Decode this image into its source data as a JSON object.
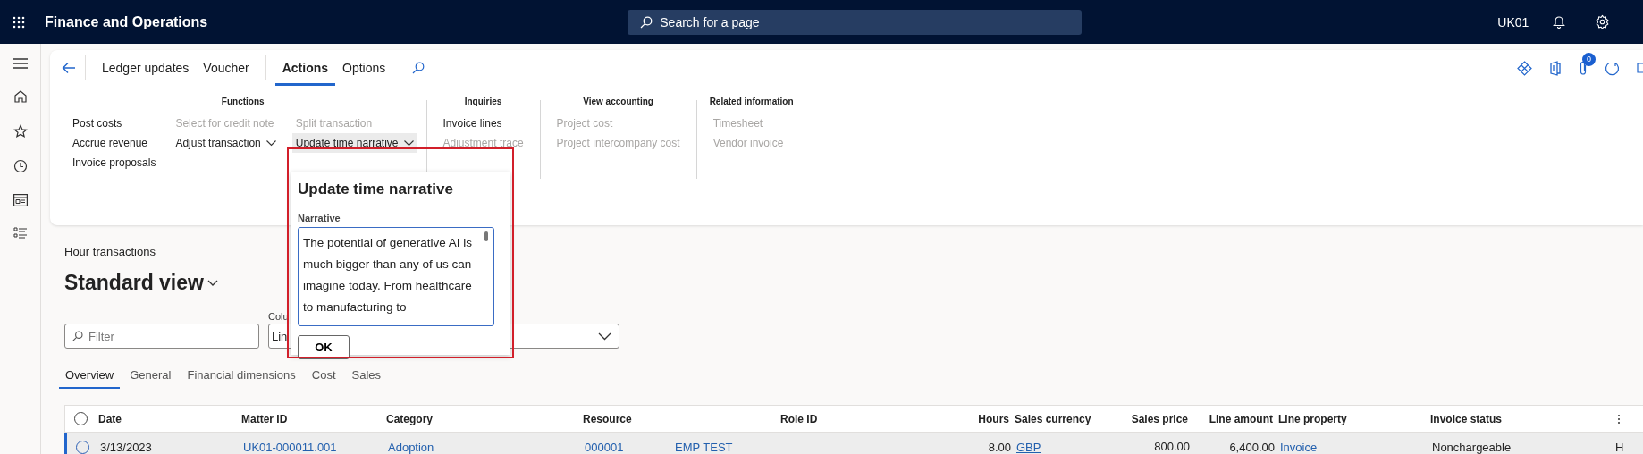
{
  "app_bar": {
    "title": "Finance and Operations",
    "search": {
      "placeholder": "Search for a page"
    },
    "company": "UK01"
  },
  "nav_rail": {
    "items": [
      {
        "kind": "menu"
      },
      {
        "kind": "home"
      },
      {
        "kind": "star"
      },
      {
        "kind": "clock"
      },
      {
        "kind": "workspace"
      },
      {
        "kind": "list"
      }
    ]
  },
  "ribbon": {
    "tabs": [
      {
        "label": "Ledger updates",
        "selected": false
      },
      {
        "label": "Voucher",
        "selected": false
      },
      {
        "label": "Actions",
        "selected": true
      },
      {
        "label": "Options",
        "selected": false
      }
    ],
    "attachments_count": "0",
    "groups": [
      {
        "title": "Functions",
        "columns": [
          [
            {
              "label": "Post costs",
              "disabled": false,
              "dropdown": false,
              "selected": false
            },
            {
              "label": "Accrue revenue",
              "disabled": false,
              "dropdown": false,
              "selected": false
            },
            {
              "label": "Invoice proposals",
              "disabled": false,
              "dropdown": false,
              "selected": false
            }
          ],
          [
            {
              "label": "Select for credit note",
              "disabled": true,
              "dropdown": false,
              "selected": false
            },
            {
              "label": "Adjust transaction",
              "disabled": false,
              "dropdown": true,
              "selected": false
            }
          ],
          [
            {
              "label": "Split transaction",
              "disabled": true,
              "dropdown": false,
              "selected": false
            },
            {
              "label": "Update time narrative",
              "disabled": false,
              "dropdown": true,
              "selected": true
            }
          ]
        ]
      },
      {
        "title": "Inquiries",
        "columns": [
          [
            {
              "label": "Invoice lines",
              "disabled": false,
              "dropdown": false,
              "selected": false
            },
            {
              "label": "Adjustment trace",
              "disabled": true,
              "dropdown": false,
              "selected": false
            }
          ]
        ]
      },
      {
        "title": "View accounting",
        "columns": [
          [
            {
              "label": "Project cost",
              "disabled": true,
              "dropdown": false,
              "selected": false
            },
            {
              "label": "Project intercompany cost",
              "disabled": true,
              "dropdown": false,
              "selected": false
            }
          ]
        ]
      },
      {
        "title": "Related information",
        "columns": [
          [
            {
              "label": "Timesheet",
              "disabled": true,
              "dropdown": false,
              "selected": false
            },
            {
              "label": "Vendor invoice",
              "disabled": true,
              "dropdown": false,
              "selected": false
            }
          ]
        ]
      }
    ]
  },
  "popup": {
    "title": "Update time narrative",
    "field_label": "Narrative",
    "value": "The potential of generative AI is much bigger than any of us can imagine today. From healthcare to manufacturing to",
    "button": "OK"
  },
  "page": {
    "caption": "Hour transactions",
    "view": "Standard view",
    "filter": {
      "placeholder": "Filter"
    },
    "column_label": "Colu",
    "column_value": "Lin",
    "tabs": [
      {
        "label": "Overview",
        "selected": true
      },
      {
        "label": "General",
        "selected": false
      },
      {
        "label": "Financial dimensions",
        "selected": false
      },
      {
        "label": "Cost",
        "selected": false
      },
      {
        "label": "Sales",
        "selected": false
      }
    ]
  },
  "table": {
    "columns": [
      {
        "label": "Date",
        "kind": "text"
      },
      {
        "label": "Matter ID",
        "kind": "text"
      },
      {
        "label": "Category",
        "kind": "text"
      },
      {
        "label": "Resource",
        "kind": "text"
      },
      {
        "kind": "text"
      },
      {
        "label": "Role ID",
        "kind": "text"
      },
      {
        "label": "Hours",
        "kind": "number"
      },
      {
        "label": "Sales currency",
        "kind": "text"
      },
      {
        "label": "Sales price",
        "kind": "number"
      },
      {
        "label": "Line amount",
        "kind": "number"
      },
      {
        "label": "Line property",
        "kind": "text"
      },
      {
        "label": "Invoice status",
        "kind": "text"
      },
      {
        "kind": "text"
      }
    ],
    "all_selected": false,
    "rows": [
      {
        "selected": false,
        "focused": true,
        "cells": [
          {
            "text": "3/13/2023",
            "kind": "text"
          },
          {
            "text": "UK01-000011.001",
            "kind": "link"
          },
          {
            "text": "Adoption",
            "kind": "link"
          },
          {
            "text": "000001",
            "kind": "link"
          },
          {
            "text": "EMP TEST",
            "kind": "link"
          },
          {
            "kind": "blank"
          },
          {
            "text": "8.00",
            "kind": "text"
          },
          {
            "text": "GBP",
            "kind": "underline"
          },
          {
            "text": "800.00",
            "kind": "input"
          },
          {
            "text": "6,400.00",
            "kind": "text"
          },
          {
            "text": "Invoice",
            "kind": "link"
          },
          {
            "text": "Nonchargeable",
            "kind": "text"
          },
          {
            "text": "H",
            "kind": "text"
          }
        ]
      }
    ]
  }
}
